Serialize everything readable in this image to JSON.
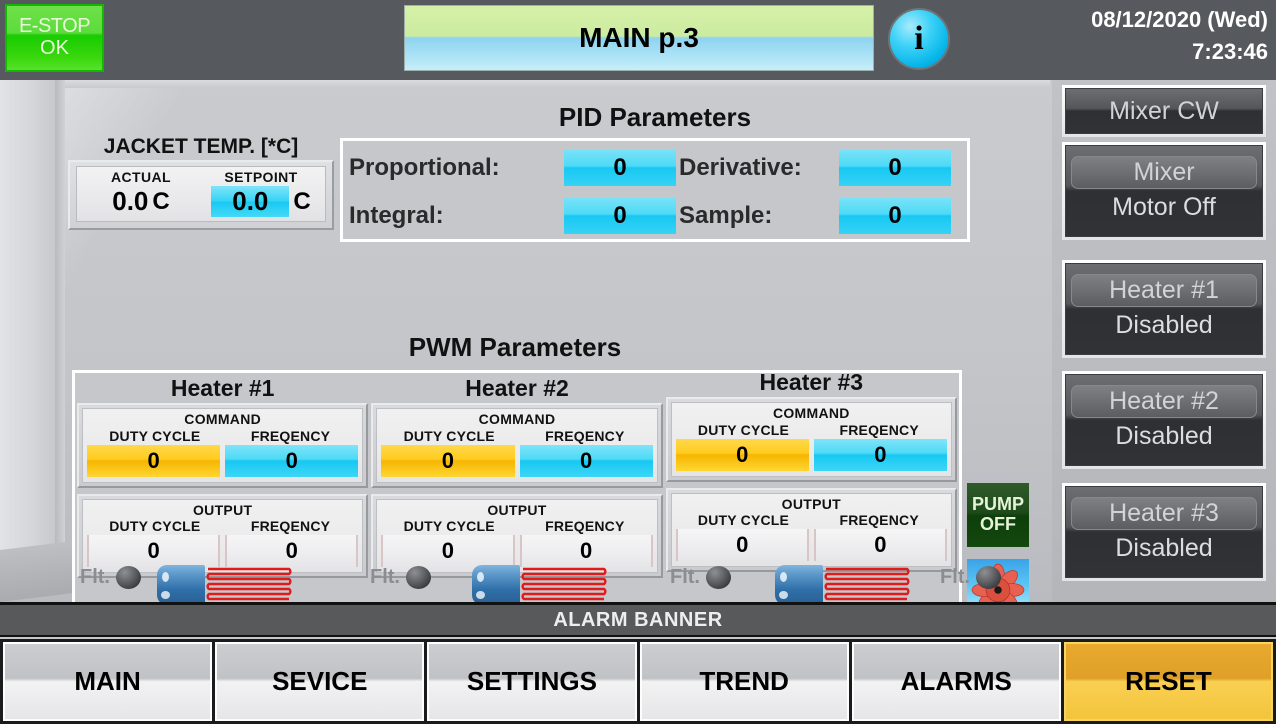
{
  "header": {
    "estop": {
      "line1": "E-STOP",
      "line2": "OK",
      "color": "#16cc00"
    },
    "title": "MAIN p.3",
    "info_icon": "i",
    "date": "08/12/2020 (Wed)",
    "time": "7:23:46"
  },
  "jacket": {
    "title": "JACKET TEMP. [*C]",
    "actual_label": "ACTUAL",
    "setpoint_label": "SETPOINT",
    "actual_value": "0.0",
    "actual_unit": "C",
    "setpoint_value": "0.0",
    "setpoint_unit": "C"
  },
  "pid": {
    "title": "PID Parameters",
    "proportional_label": "Proportional:",
    "proportional_value": "0",
    "derivative_label": "Derivative:",
    "derivative_value": "0",
    "integral_label": "Integral:",
    "integral_value": "0",
    "sample_label": "Sample:",
    "sample_value": "0"
  },
  "pwm": {
    "title": "PWM Parameters",
    "command_caption": "COMMAND",
    "output_caption": "OUTPUT",
    "duty_label": "DUTY CYCLE",
    "freq_label": "FREQENCY",
    "heaters": [
      {
        "title": "Heater #1",
        "command_duty": "0",
        "command_freq": "0",
        "output_duty": "0",
        "output_freq": "0"
      },
      {
        "title": "Heater #2",
        "command_duty": "0",
        "command_freq": "0",
        "output_duty": "0",
        "output_freq": "0"
      },
      {
        "title": "Heater #3",
        "command_duty": "0",
        "command_freq": "0",
        "output_duty": "0",
        "output_freq": "0"
      }
    ]
  },
  "pump": {
    "label": "PUMP",
    "state": "OFF"
  },
  "faults": [
    {
      "label": "Flt."
    },
    {
      "label": "Flt."
    },
    {
      "label": "Flt."
    },
    {
      "label": "Flt."
    }
  ],
  "sidebar": [
    {
      "top": "Mixer CW",
      "bottom": ""
    },
    {
      "top": "Mixer",
      "bottom": "Motor Off"
    },
    {
      "top": "Heater #1",
      "bottom": "Disabled"
    },
    {
      "top": "Heater #2",
      "bottom": "Disabled"
    },
    {
      "top": "Heater #3",
      "bottom": "Disabled"
    }
  ],
  "alarm_banner": "ALARM BANNER",
  "nav": [
    {
      "label": "MAIN"
    },
    {
      "label": "SEVICE"
    },
    {
      "label": "SETTINGS"
    },
    {
      "label": "TREND"
    },
    {
      "label": "ALARMS"
    },
    {
      "label": "RESET",
      "accent": "#f3c43c"
    }
  ]
}
